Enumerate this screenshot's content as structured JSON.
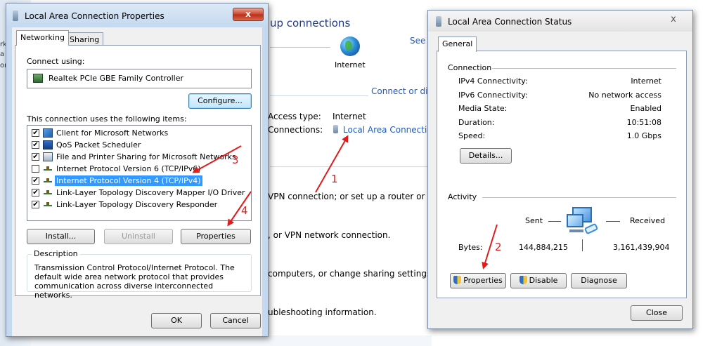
{
  "background": {
    "sidebar_fragments": [
      "rk",
      "a",
      "or"
    ],
    "title": "up connections",
    "see_full": "See f",
    "internet_label": "Internet",
    "connect_or": "Connect or dis",
    "access_type_label": "Access type:",
    "access_type_value": "Internet",
    "connections_label": "Connections:",
    "connections_value": "Local Area Connection",
    "tasks": [
      "VPN connection; or set up a router or access",
      ", or VPN network connection.",
      "computers, or change sharing settings.",
      "ubleshooting information."
    ]
  },
  "props_dialog": {
    "title": "Local Area Connection Properties",
    "close": "x",
    "tabs": [
      "Networking",
      "Sharing"
    ],
    "connect_using_label": "Connect using:",
    "adapter": "Realtek PCIe GBE Family Controller",
    "configure_button": "Configure...",
    "items_label": "This connection uses the following items:",
    "items": [
      {
        "label": "Client for Microsoft Networks",
        "checked": true,
        "icon": "network-client-icon"
      },
      {
        "label": "QoS Packet Scheduler",
        "checked": true,
        "icon": "scheduler-icon"
      },
      {
        "label": "File and Printer Sharing for Microsoft Networks",
        "checked": true,
        "icon": "printer-sharing-icon"
      },
      {
        "label": "Internet Protocol Version 6 (TCP/IPv6)",
        "checked": false,
        "icon": "protocol-icon"
      },
      {
        "label": "Internet Protocol Version 4 (TCP/IPv4)",
        "checked": true,
        "icon": "protocol-icon",
        "selected": true
      },
      {
        "label": "Link-Layer Topology Discovery Mapper I/O Driver",
        "checked": true,
        "icon": "protocol-icon"
      },
      {
        "label": "Link-Layer Topology Discovery Responder",
        "checked": true,
        "icon": "protocol-icon"
      }
    ],
    "install_button": "Install...",
    "uninstall_button": "Uninstall",
    "properties_button": "Properties",
    "description_label": "Description",
    "description_text": "Transmission Control Protocol/Internet Protocol. The default wide area network protocol that provides communication across diverse interconnected networks.",
    "ok_button": "OK",
    "cancel_button": "Cancel"
  },
  "status_dialog": {
    "title": "Local Area Connection Status",
    "close": "x",
    "tab": "General",
    "connection_label": "Connection",
    "rows": [
      {
        "label": "IPv4 Connectivity:",
        "value": "Internet"
      },
      {
        "label": "IPv6 Connectivity:",
        "value": "No network access"
      },
      {
        "label": "Media State:",
        "value": "Enabled"
      },
      {
        "label": "Duration:",
        "value": "10:51:08"
      },
      {
        "label": "Speed:",
        "value": "1.0 Gbps"
      }
    ],
    "details_button": "Details...",
    "activity_label": "Activity",
    "sent_label": "Sent",
    "received_label": "Received",
    "bytes_label": "Bytes:",
    "bytes_sent": "144,884,215",
    "bytes_received": "3,161,439,904",
    "properties_button": "Properties",
    "disable_button": "Disable",
    "diagnose_button": "Diagnose",
    "close_button": "Close"
  },
  "annotations": [
    "1",
    "2",
    "3",
    "4"
  ],
  "colors": {
    "arrow": "#e11b1b",
    "selection": "#3399ff",
    "link": "#1f5bbf"
  }
}
